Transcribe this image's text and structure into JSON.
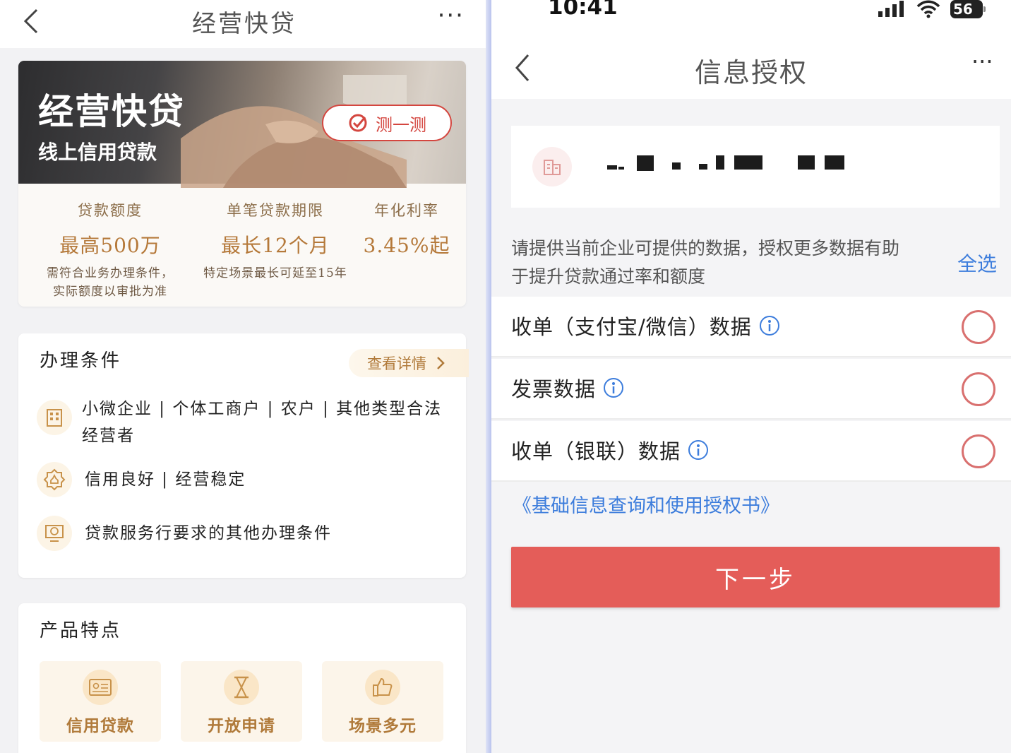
{
  "left": {
    "nav": {
      "title": "经营快贷",
      "more": "···"
    },
    "banner": {
      "title": "经营快贷",
      "subtitle": "线上信用贷款",
      "test_button": "测一测"
    },
    "metrics": [
      {
        "label": "贷款额度",
        "value": "最高500万",
        "note": "需符合业务办理条件，\n实际额度以审批为准"
      },
      {
        "label": "单笔贷款期限",
        "value": "最长12个月",
        "note": "特定场景最长可延至15年"
      },
      {
        "label": "年化利率",
        "value": "3.45%起",
        "note": ""
      }
    ],
    "conditions": {
      "title": "办理条件",
      "detail_link": "查看详情",
      "items": [
        {
          "icon": "building-icon",
          "text": "小微企业 | 个体工商户 | 农户 | 其他类型合法经营者"
        },
        {
          "icon": "credit-badge-icon",
          "text": "信用良好 | 经营稳定"
        },
        {
          "icon": "loan-service-icon",
          "text": "贷款服务行要求的其他办理条件"
        }
      ]
    },
    "features": {
      "title": "产品特点",
      "items": [
        {
          "icon": "id-card-icon",
          "label": "信用贷款"
        },
        {
          "icon": "hourglass-icon",
          "label": "开放申请"
        },
        {
          "icon": "thumbs-up-icon",
          "label": "场景多元"
        }
      ]
    }
  },
  "right": {
    "status_bar": {
      "time": "10:41",
      "battery": "56"
    },
    "nav": {
      "title": "信息授权",
      "more": "···"
    },
    "company": {
      "icon": "building-icon"
    },
    "hint": "请提供当前企业可提供的数据，授权更多数据有助于提升贷款通过率和额度",
    "select_all": "全选",
    "options": [
      {
        "label": "收单（支付宝/微信）数据"
      },
      {
        "label": "发票数据"
      },
      {
        "label": "收单（银联）数据"
      }
    ],
    "auth_link": "《基础信息查询和使用授权书》",
    "next_button": "下一步"
  },
  "colors": {
    "accent_gold": "#b5793a",
    "accent_red": "#e45d59",
    "link_blue": "#3d7ddc"
  }
}
